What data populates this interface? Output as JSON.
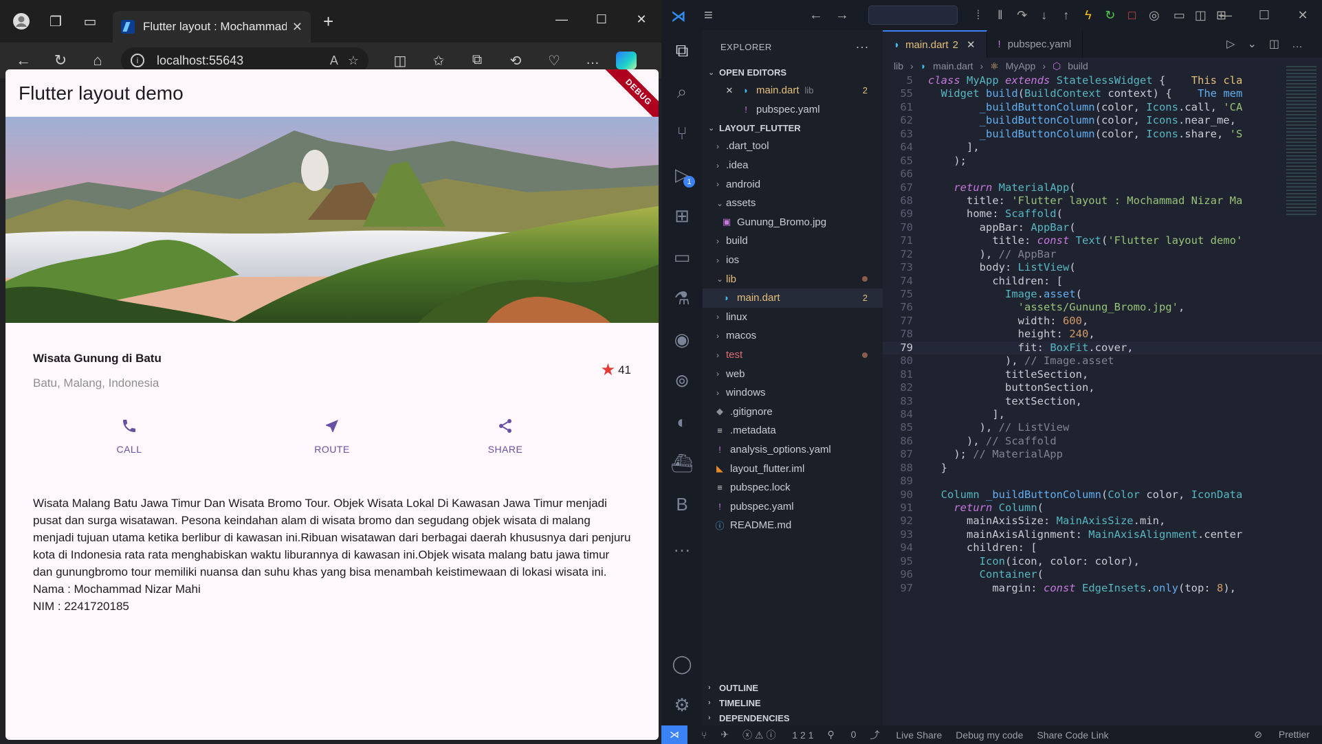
{
  "browser": {
    "tab_title": "Flutter layout : Mochammad Nizar Mahi",
    "url": "localhost:55643",
    "app": {
      "appbar_title": "Flutter layout demo",
      "debug_banner": "DEBUG",
      "title_section": {
        "name": "Wisata Gunung di Batu",
        "location": "Batu, Malang, Indonesia",
        "star_count": "41"
      },
      "buttons": [
        {
          "label": "CALL"
        },
        {
          "label": "ROUTE"
        },
        {
          "label": "SHARE"
        }
      ],
      "text_section": [
        "Wisata Malang Batu Jawa Timur Dan Wisata Bromo Tour. Objek Wisata Lokal Di Kawasan Jawa Timur menjadi pusat dan surga wisatawan. Pesona keindahan alam di wisata bromo dan segudang objek wisata di malang menjadi tujuan utama ketika berlibur di kawasan ini.Ribuan wisatawan dari berbagai daerah khususnya dari penjuru kota di Indonesia rata rata menghabiskan waktu liburannya di kawasan ini.Objek wisata malang batu jawa timur dan gunungbromo tour memiliki nuansa dan suhu khas yang bisa menambah keistimewaan di lokasi wisata ini.",
        "Nama : Mochammad Nizar Mahi",
        "NIM :  2241720185"
      ],
      "accent": "#6750a4",
      "star_color": "#e53935"
    }
  },
  "vscode": {
    "explorer_title": "EXPLORER",
    "open_editors_label": "OPEN EDITORS",
    "open_editors": [
      {
        "name": "main.dart",
        "dir": "lib",
        "count": "2"
      },
      {
        "name": "pubspec.yaml"
      }
    ],
    "project_label": "LAYOUT_FLUTTER",
    "tree": [
      {
        "name": ".dart_tool"
      },
      {
        "name": ".idea"
      },
      {
        "name": "android"
      },
      {
        "name": "assets"
      },
      {
        "name": "Gunung_Bromo.jpg"
      },
      {
        "name": "build"
      },
      {
        "name": "ios"
      },
      {
        "name": "lib"
      },
      {
        "name": "main.dart",
        "count": "2"
      },
      {
        "name": "linux"
      },
      {
        "name": "macos"
      },
      {
        "name": "test"
      },
      {
        "name": "web"
      },
      {
        "name": "windows"
      },
      {
        "name": ".gitignore"
      },
      {
        "name": ".metadata"
      },
      {
        "name": "analysis_options.yaml"
      },
      {
        "name": "layout_flutter.iml"
      },
      {
        "name": "pubspec.lock"
      },
      {
        "name": "pubspec.yaml"
      },
      {
        "name": "README.md"
      }
    ],
    "footer_sections": [
      "OUTLINE",
      "TIMELINE",
      "DEPENDENCIES"
    ],
    "tabs": [
      {
        "name": "main.dart",
        "count": "2"
      },
      {
        "name": "pubspec.yaml"
      }
    ],
    "breadcrumbs": [
      "lib",
      "main.dart",
      "MyApp",
      "build"
    ],
    "status": {
      "problems": "1  2  1",
      "ports": "0",
      "live_share": "Live Share",
      "debug": "Debug my code",
      "share_link": "Share Code Link",
      "prettier": "Prettier"
    },
    "code_lines": [
      {
        "n": "5",
        "html": "<span class='kw'>class</span> <span class='ty'>MyApp</span> <span class='kw'>extends</span> <span class='ty'>StatelessWidget</span> {    <span class='pr'>This cla</span>"
      },
      {
        "n": "55",
        "html": "  <span class='ty'>Widget</span> <span class='fn'>build</span>(<span class='ty'>BuildContext</span> context) {    <span class='fn'>The mem</span>"
      },
      {
        "n": "61",
        "html": "        <span class='fn'>_buildButtonColumn</span>(color, <span class='ty'>Icons</span>.call, <span class='st'>'CA</span>"
      },
      {
        "n": "62",
        "html": "        <span class='fn'>_buildButtonColumn</span>(color, <span class='ty'>Icons</span>.near_me,"
      },
      {
        "n": "63",
        "html": "        <span class='fn'>_buildButtonColumn</span>(color, <span class='ty'>Icons</span>.share, <span class='st'>'S</span>"
      },
      {
        "n": "64",
        "html": "      ],"
      },
      {
        "n": "65",
        "html": "    );"
      },
      {
        "n": "66",
        "html": ""
      },
      {
        "n": "67",
        "html": "    <span class='kw'>return</span> <span class='ty'>MaterialApp</span>("
      },
      {
        "n": "68",
        "html": "      title: <span class='st'>'Flutter layout : Mochammad Nizar Ma</span>"
      },
      {
        "n": "69",
        "html": "      home: <span class='ty'>Scaffold</span>("
      },
      {
        "n": "70",
        "html": "        appBar: <span class='ty'>AppBar</span>("
      },
      {
        "n": "71",
        "html": "          title: <span class='kw'>const</span> <span class='ty'>Text</span>(<span class='st'>'Flutter layout demo'</span>"
      },
      {
        "n": "72",
        "html": "        ), <span class='cm'>// AppBar</span>"
      },
      {
        "n": "73",
        "html": "        body: <span class='ty'>ListView</span>("
      },
      {
        "n": "74",
        "html": "          children: ["
      },
      {
        "n": "75",
        "html": "            <span class='ty'>Image</span>.<span class='fn'>asset</span>("
      },
      {
        "n": "76",
        "html": "              <span class='st'>'assets/Gunung_Bromo.jpg'</span>,"
      },
      {
        "n": "77",
        "html": "              width: <span class='nu'>600</span>,"
      },
      {
        "n": "78",
        "html": "              height: <span class='nu'>240</span>,"
      },
      {
        "n": "79",
        "html": "              fit: <span class='ty'>BoxFit</span>.cover,"
      },
      {
        "n": "80",
        "html": "            ), <span class='cm'>// Image.asset</span>"
      },
      {
        "n": "81",
        "html": "            titleSection,"
      },
      {
        "n": "82",
        "html": "            buttonSection,"
      },
      {
        "n": "83",
        "html": "            textSection,"
      },
      {
        "n": "84",
        "html": "          ],"
      },
      {
        "n": "85",
        "html": "        ), <span class='cm'>// ListView</span>"
      },
      {
        "n": "86",
        "html": "      ), <span class='cm'>// Scaffold</span>"
      },
      {
        "n": "87",
        "html": "    ); <span class='cm'>// MaterialApp</span>"
      },
      {
        "n": "88",
        "html": "  }"
      },
      {
        "n": "89",
        "html": ""
      },
      {
        "n": "90",
        "html": "  <span class='ty'>Column</span> <span class='fn'>_buildButtonColumn</span>(<span class='ty'>Color</span> color, <span class='ty'>IconData</span>"
      },
      {
        "n": "91",
        "html": "    <span class='kw'>return</span> <span class='ty'>Column</span>("
      },
      {
        "n": "92",
        "html": "      mainAxisSize: <span class='ty'>MainAxisSize</span>.min,"
      },
      {
        "n": "93",
        "html": "      mainAxisAlignment: <span class='ty'>MainAxisAlignment</span>.center"
      },
      {
        "n": "94",
        "html": "      children: ["
      },
      {
        "n": "95",
        "html": "        <span class='ty'>Icon</span>(icon, color: color),"
      },
      {
        "n": "96",
        "html": "        <span class='ty'>Container</span>("
      },
      {
        "n": "97",
        "html": "          margin: <span class='kw'>const</span> <span class='ty'>EdgeInsets</span>.<span class='fn'>only</span>(top: <span class='nu'>8</span>),"
      }
    ],
    "current_line": "79"
  }
}
